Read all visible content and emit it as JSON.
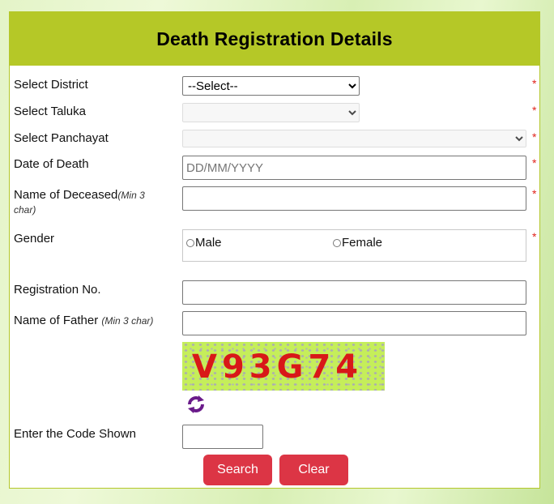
{
  "form": {
    "title": "Death Registration Details",
    "required_mark": "*",
    "fields": {
      "district": {
        "label": "Select District",
        "selected": "--Select--"
      },
      "taluka": {
        "label": "Select Taluka",
        "selected": ""
      },
      "panchayat": {
        "label": "Select Panchayat",
        "selected": ""
      },
      "date_of_death": {
        "label": "Date of Death",
        "placeholder": "DD/MM/YYYY",
        "value": ""
      },
      "deceased_name": {
        "label": "Name of Deceased",
        "hint": "(Min 3 char)",
        "value": ""
      },
      "gender": {
        "label": "Gender",
        "options": [
          "Male",
          "Female"
        ],
        "selected": null
      },
      "registration_no": {
        "label": "Registration No.",
        "value": ""
      },
      "father_name": {
        "label": "Name of Father",
        "hint": "(Min 3 char)",
        "value": ""
      },
      "captcha": {
        "code_shown": "V93G74",
        "refresh_icon": "refresh-icon"
      },
      "captcha_input": {
        "label": "Enter the Code Shown",
        "value": ""
      }
    },
    "buttons": {
      "search": "Search",
      "clear": "Clear"
    }
  },
  "colors": {
    "header_bg": "#b5c827",
    "button_bg": "#dc3545",
    "required": "#e0241c",
    "captcha_text": "#d81818",
    "captcha_bg": "#c5ee5a",
    "refresh_icon": "#6a1b8a"
  }
}
